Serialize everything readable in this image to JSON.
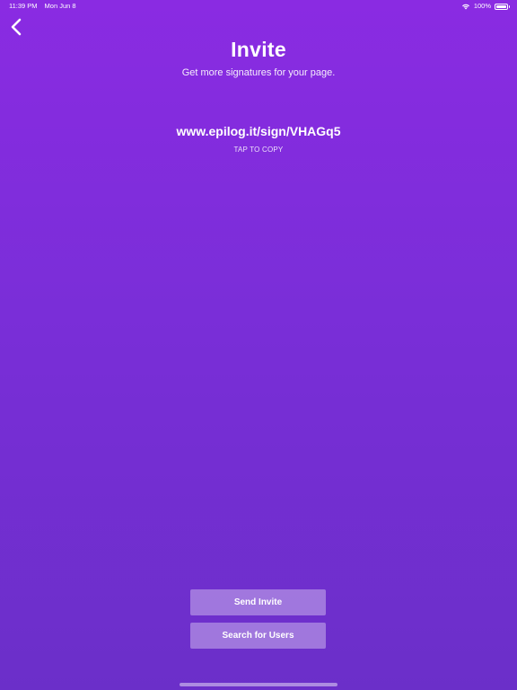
{
  "status_bar": {
    "time": "11:39 PM",
    "date": "Mon Jun 8",
    "battery_percent": "100%",
    "wifi_icon": "wifi-icon",
    "battery_icon": "battery-icon"
  },
  "nav": {
    "back_icon": "chevron-left-icon"
  },
  "header": {
    "title": "Invite",
    "subtitle": "Get more signatures for your page."
  },
  "invite": {
    "link": "www.epilog.it/sign/VHAGq5",
    "copy_hint": "TAP TO COPY"
  },
  "actions": {
    "send_invite_label": "Send Invite",
    "search_users_label": "Search for Users"
  },
  "colors": {
    "background_top": "#8A2BE2",
    "background_bottom": "#6B2FC9",
    "text": "#FFFFFF"
  }
}
